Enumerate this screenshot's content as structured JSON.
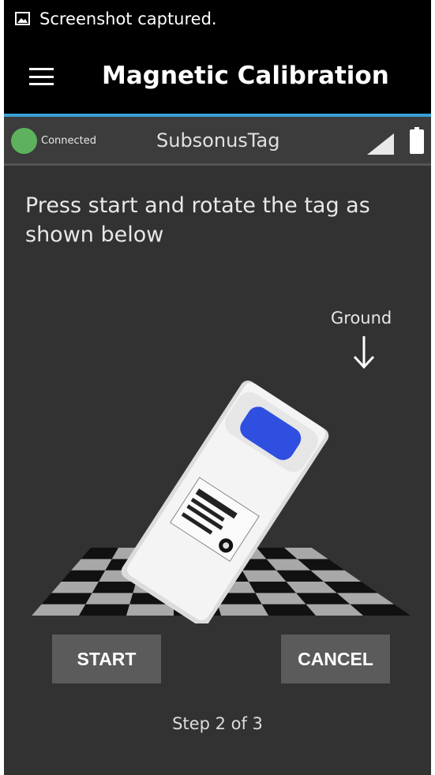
{
  "status_bar": {
    "text": "Screenshot captured."
  },
  "app_bar": {
    "title": "Magnetic Calibration"
  },
  "connection": {
    "status": "Connected",
    "device": "SubsonusTag",
    "status_color": "#5eb25d"
  },
  "instructions": "Press start and rotate the tag as shown below",
  "orientation": {
    "ground_label": "Ground"
  },
  "buttons": {
    "start": "START",
    "cancel": "CANCEL"
  },
  "step": "Step 2 of 3",
  "colors": {
    "accent": "#3aa0d4",
    "background": "#323232",
    "bar": "#000000",
    "button": "#5b5b5b"
  },
  "icons": [
    "image-icon",
    "menu-icon",
    "signal-icon",
    "battery-icon",
    "arrow-down-icon"
  ]
}
